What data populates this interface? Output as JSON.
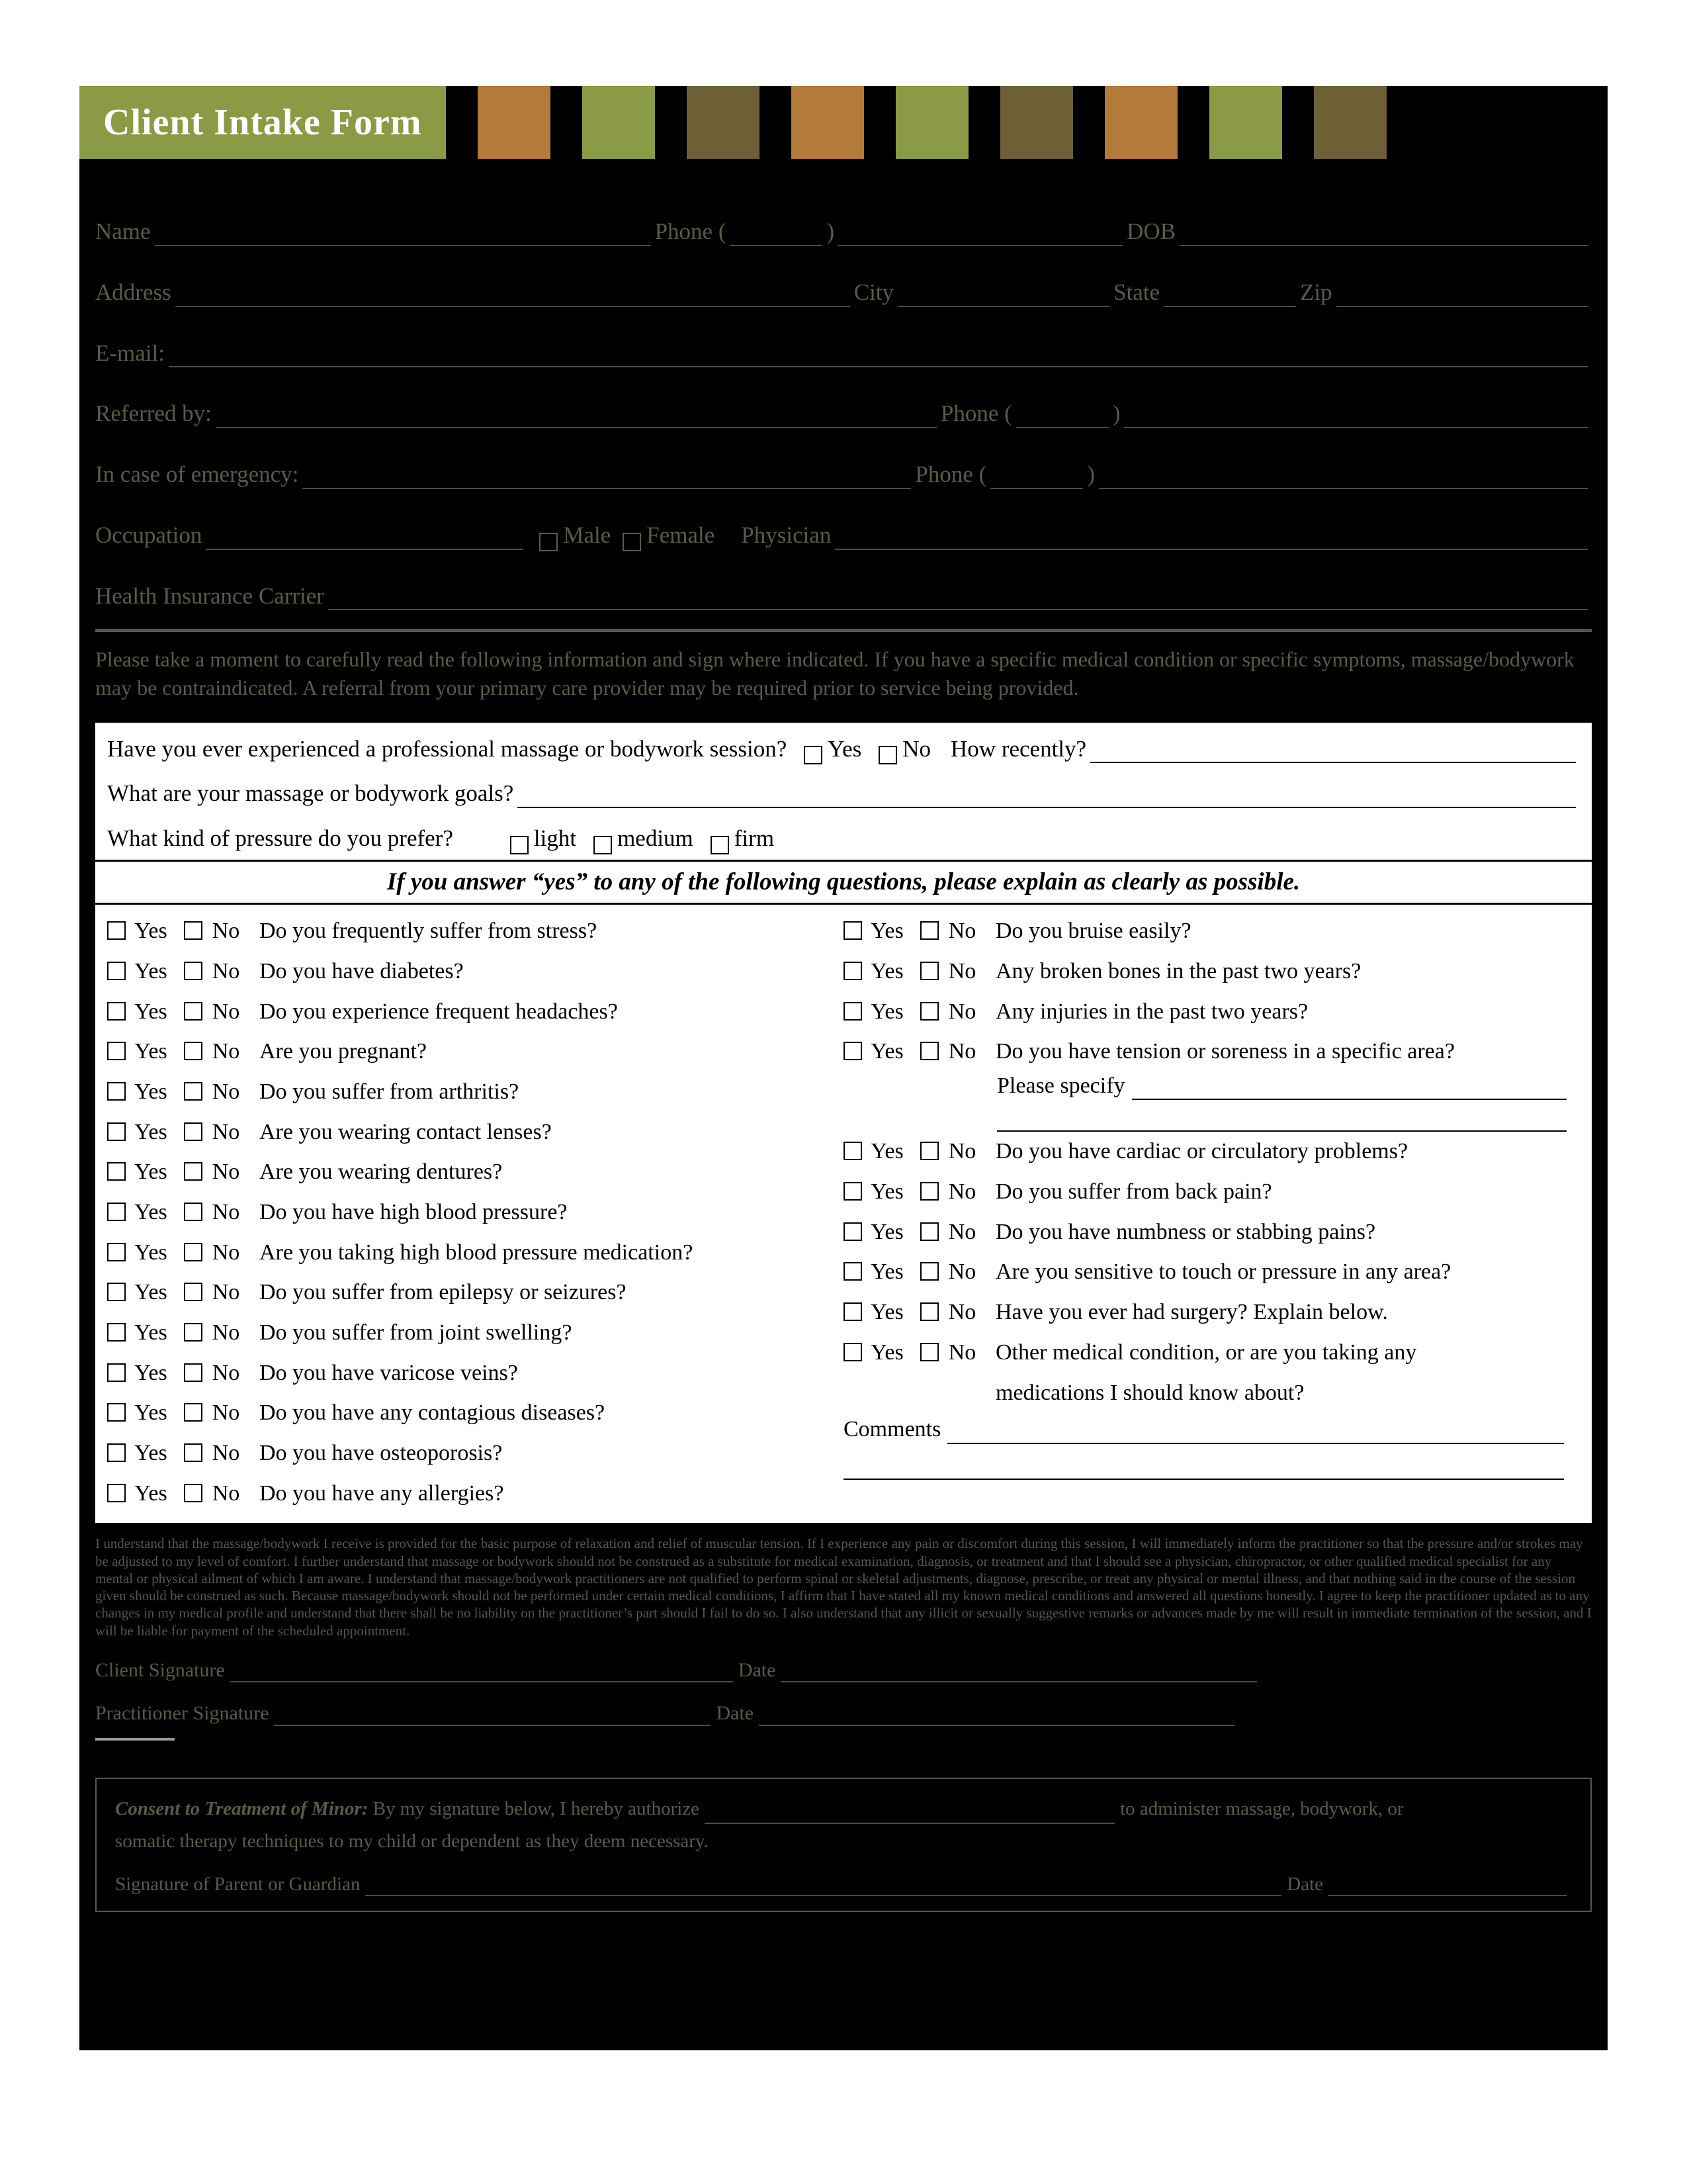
{
  "title": "Client Intake Form",
  "header_squares": [
    "#b37a3a",
    "#8a9a45",
    "#6e6036",
    "#b37a3a",
    "#8a9a45",
    "#6e6036",
    "#b37a3a",
    "#8a9a45",
    "#6e6036"
  ],
  "labels": {
    "name": "Name",
    "phone": "Phone (",
    "phone_close": ")",
    "dob": "DOB",
    "address": "Address",
    "city": "City",
    "state": "State",
    "zip": "Zip",
    "email": "E-mail:",
    "referred": "Referred by:",
    "ref_phone": "Phone (",
    "emergency": "In case of emergency:",
    "em_phone": "Phone (",
    "occupation": "Occupation",
    "male": "Male",
    "female": "Female",
    "physician": "Physician",
    "hic": "Health Insurance Carrier"
  },
  "preamble": "Please take a moment to carefully read the following information and sign where indicated. If you have a specific medical condition or specific symptoms, massage/bodywork may be contraindicated. A referral from your primary care provider may be required prior to service being provided.",
  "whitebox": {
    "q1": "Have you ever experienced a professional massage or bodywork session?",
    "yes": "Yes",
    "no": "No",
    "recent": "How recently?",
    "q2": "What are your massage or bodywork goals?",
    "q3": "What kind of pressure do you prefer?",
    "light": "light",
    "medium": "medium",
    "firm": "firm",
    "banner": "If you answer “yes” to any of the following questions, please explain as clearly as possible."
  },
  "yn": {
    "yes": "Yes",
    "no": "No"
  },
  "left_questions": [
    "Do you frequently suffer from stress?",
    "Do you have diabetes?",
    "Do you experience frequent headaches?",
    "Are you pregnant?",
    "Do you suffer from arthritis?",
    "Are you wearing contact lenses?",
    "Are you wearing dentures?",
    "Do you have high blood pressure?",
    "Are you taking high blood pressure medication?",
    "Do you suffer from epilepsy or seizures?",
    "Do you suffer from joint swelling?",
    "Do you have varicose veins?",
    "Do you have any contagious diseases?",
    "Do you have osteoporosis?",
    "Do you have any allergies?"
  ],
  "right_questions_top": [
    "Do you bruise easily?",
    "Any broken bones in the past two years?",
    "Any injuries in the past two years?",
    "Do you have tension or soreness in a specific area?"
  ],
  "please_specify": "Please specify",
  "right_questions_bottom": [
    "Do you have cardiac or circulatory problems?",
    "Do you suffer from back pain?",
    "Do you have numbness or stabbing pains?",
    "Are you sensitive to touch or pressure in any area?",
    "Have you ever had surgery? Explain below.",
    "Other medical condition, or are you taking any"
  ],
  "right_cont": "medications I should know about?",
  "comments": "Comments",
  "disclosure": "I understand that the massage/bodywork I receive is provided for the basic purpose of relaxation and relief of muscular tension. If I experience any pain or discomfort during this session, I will immediately inform the practitioner so that the pressure and/or strokes may be adjusted to my level of comfort. I further understand that massage or bodywork should not be construed as a substitute for medical examination, diagnosis, or treatment and that I should see a physician, chiropractor, or other qualified medical specialist for any mental or physical ailment of which I am aware. I understand that massage/bodywork practitioners are not qualified to perform spinal or skeletal adjustments, diagnose, prescribe, or treat any physical or mental illness, and that nothing said in the course of the session given should be construed as such. Because massage/bodywork should not be performed under certain medical conditions, I affirm that I have stated all my known medical conditions and answered all questions honestly. I agree to keep the practitioner updated as to any changes in my medical profile and understand that there shall be no liability on the practitioner’s part should I fail to do so. I also understand that any illicit or sexually suggestive remarks or advances made by me will result in immediate termination of the session, and I will be liable for payment of the scheduled appointment.",
  "sig": {
    "client": "Client Signature",
    "date": "Date",
    "pract": "Practitioner Signature"
  },
  "minor": {
    "heading": "Consent to Treatment of Minor:",
    "body1": "By my signature below, I hereby authorize",
    "body2": "to administer massage, bodywork, or",
    "body3": "somatic therapy techniques to my child or dependent as they deem necessary.",
    "sig": "Signature of Parent or Guardian",
    "date": "Date"
  }
}
